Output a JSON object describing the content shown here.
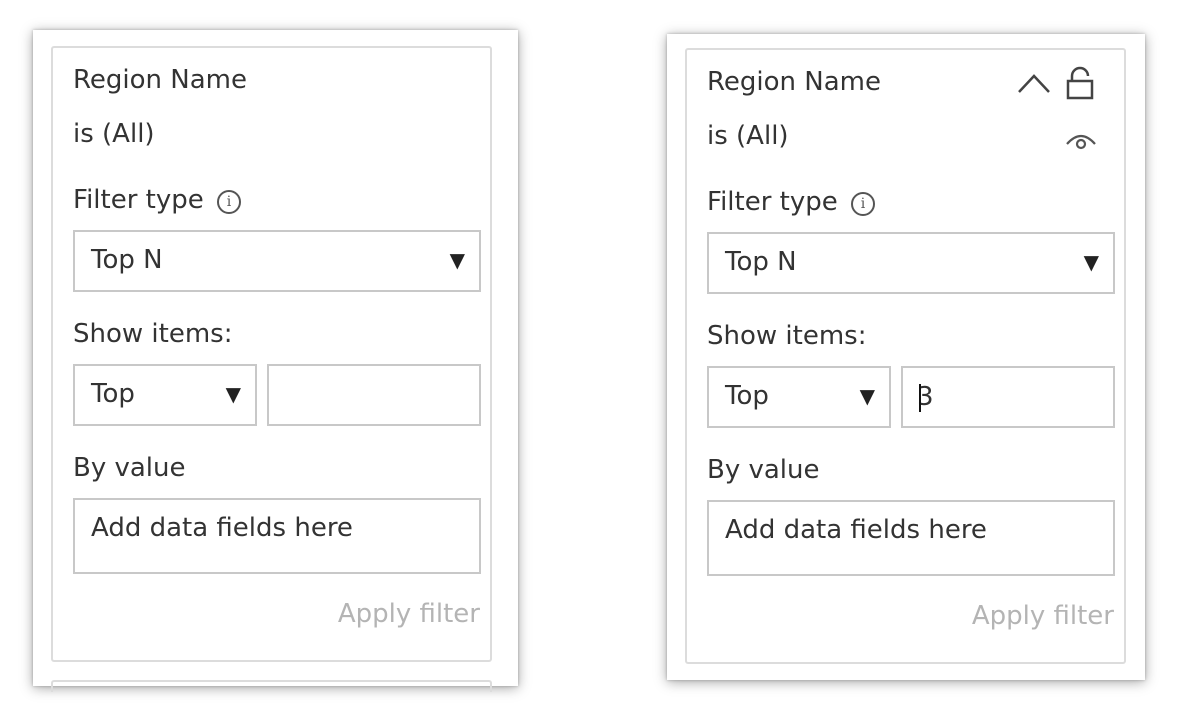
{
  "panels": [
    {
      "title": "Region Name",
      "condition": "is (All)",
      "filter_type_label": "Filter type",
      "filter_type_value": "Top N",
      "show_items_label": "Show items:",
      "show_direction": "Top",
      "count_value": "",
      "by_value_label": "By value",
      "drop_zone_text": "Add data fields here",
      "apply_label": "Apply filter"
    },
    {
      "title": "Region Name",
      "condition": "is (All)",
      "filter_type_label": "Filter type",
      "filter_type_value": "Top N",
      "show_items_label": "Show items:",
      "show_direction": "Top",
      "count_value": "3",
      "by_value_label": "By value",
      "drop_zone_text": "Add data fields here",
      "apply_label": "Apply filter"
    }
  ],
  "icons": {
    "info": "info-icon",
    "caret": "caret-down-icon",
    "collapse": "chevron-up-icon",
    "lock": "lock-icon",
    "visibility": "eye-icon"
  },
  "colors": {
    "text": "#333333",
    "border": "#c8c8c8",
    "card_border": "#dcdcdc",
    "disabled_text": "#b4b4b4"
  }
}
